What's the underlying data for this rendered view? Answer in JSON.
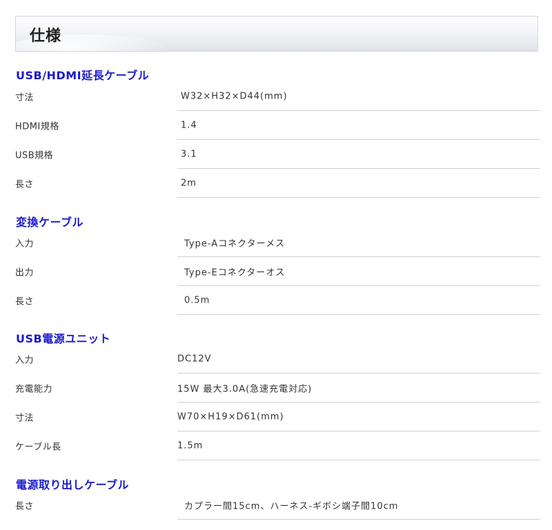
{
  "header": {
    "title": "仕様"
  },
  "sections": [
    {
      "title": "USB/HDMI延長ケーブル",
      "rows": [
        {
          "label": "寸法",
          "value": "W32×H32×D44(mm)"
        },
        {
          "label": "HDMI規格",
          "value": "1.4"
        },
        {
          "label": "USB規格",
          "value": "3.1"
        },
        {
          "label": "長さ",
          "value": "2m"
        }
      ]
    },
    {
      "title": "変換ケーブル",
      "rows": [
        {
          "label": "入力",
          "value": "Type-Aコネクターメス"
        },
        {
          "label": "出力",
          "value": "Type-Eコネクターオス"
        },
        {
          "label": "長さ",
          "value": "0.5m"
        }
      ]
    },
    {
      "title": "USB電源ユニット",
      "rows": [
        {
          "label": "入力",
          "value": "DC12V"
        },
        {
          "label": "充電能力",
          "value": "15W 最大3.0A(急速充電対応)"
        },
        {
          "label": "寸法",
          "value": "W70×H19×D61(mm)"
        },
        {
          "label": "ケーブル長",
          "value": "1.5m"
        }
      ]
    },
    {
      "title": "電源取り出しケーブル",
      "rows": [
        {
          "label": "長さ",
          "value": "カプラー間15cm、ハーネス-ギボシ端子間10cm"
        }
      ]
    }
  ]
}
